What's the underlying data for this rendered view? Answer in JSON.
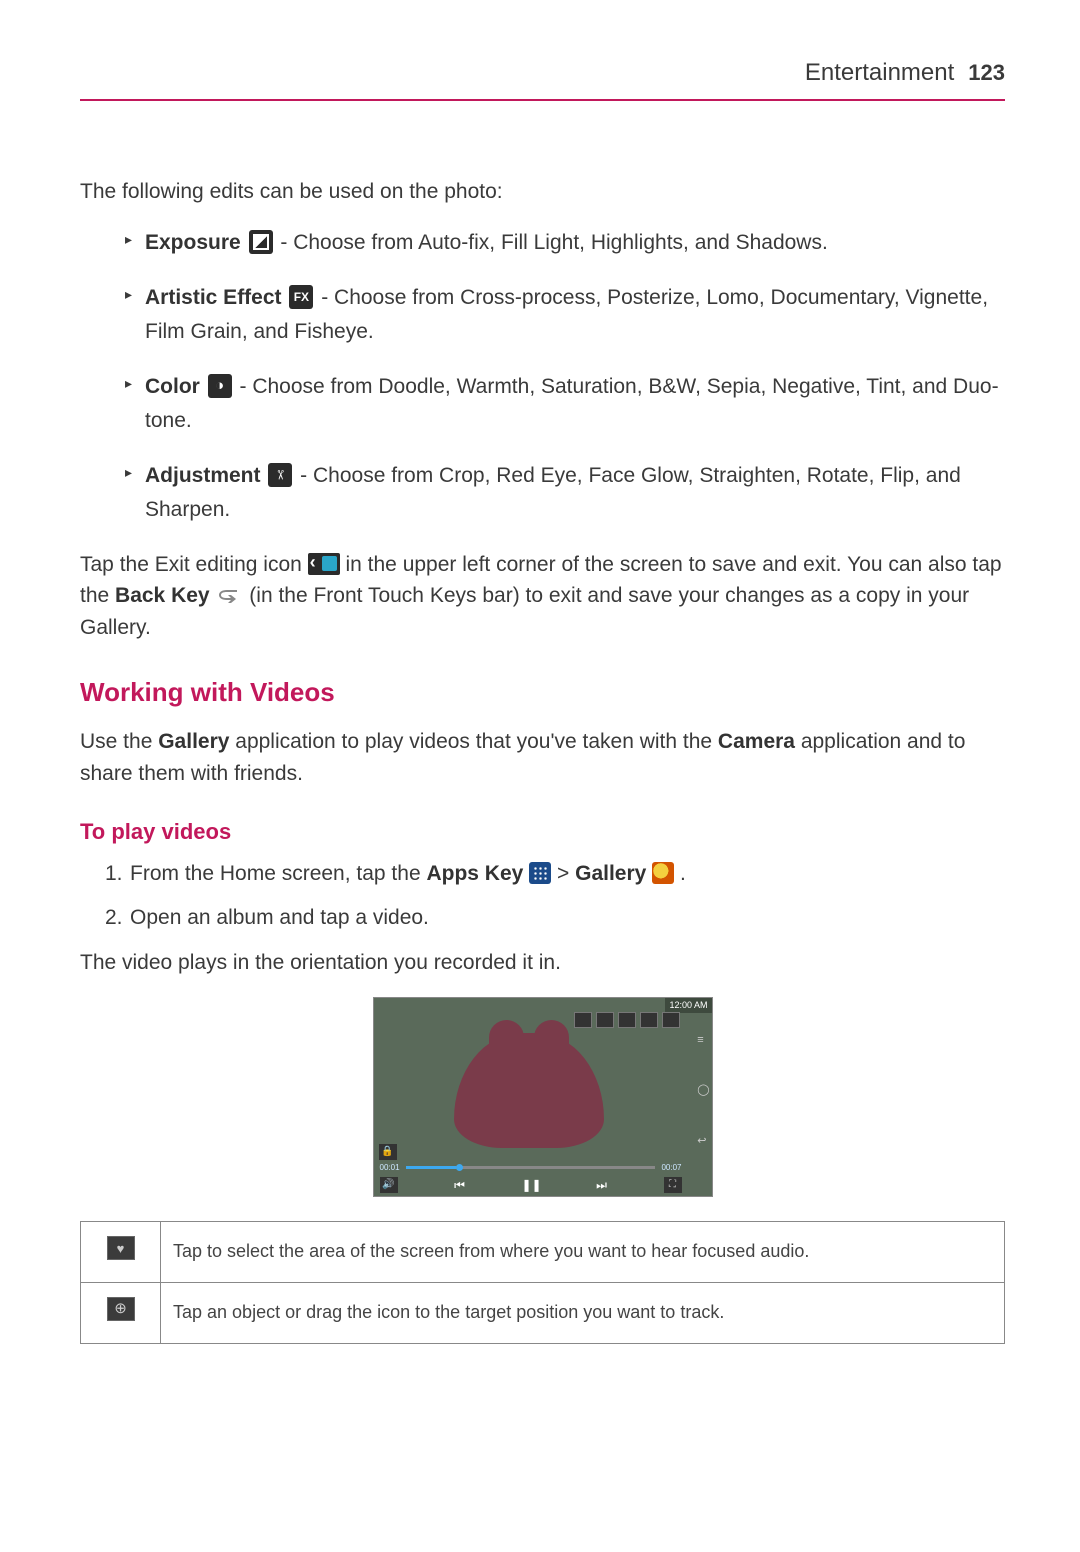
{
  "header": {
    "section": "Entertainment",
    "page": "123"
  },
  "intro": "The following edits can be used on the photo:",
  "edits": [
    {
      "label": "Exposure",
      "desc": " - Choose from Auto-fix, Fill Light, Highlights, and Shadows."
    },
    {
      "label": "Artistic Effect",
      "desc": " - Choose from Cross-process, Posterize, Lomo, Documentary, Vignette, Film Grain, and Fisheye."
    },
    {
      "label": "Color",
      "desc": " - Choose from Doodle, Warmth, Saturation, B&W, Sepia, Negative, Tint, and Duo-tone."
    },
    {
      "label": "Adjustment",
      "desc": " - Choose from Crop, Red Eye, Face Glow, Straighten, Rotate, Flip, and Sharpen."
    }
  ],
  "exit_para": {
    "p1": "Tap the Exit editing icon ",
    "p2": " in the upper left corner of the screen to save and exit.  You can also tap the ",
    "back_label": "Back Key",
    "p3": "  (in the Front Touch Keys bar) to exit and save your changes as a copy in your Gallery."
  },
  "videos": {
    "heading": "Working with Videos",
    "p_a": "Use the ",
    "gallery_b": "Gallery",
    "p_b": " application to play videos that you've taken with the ",
    "camera_b": "Camera",
    "p_c": " application and to share them with friends."
  },
  "play": {
    "heading": "To play videos",
    "steps": {
      "s1_a": "From the Home screen, tap the ",
      "s1_apps": "Apps Key",
      "s1_b": " > ",
      "s1_gallery": "Gallery",
      "s1_c": " .",
      "s2": "Open an album and tap a video."
    },
    "after": "The video plays in the orientation you recorded it in."
  },
  "shot": {
    "status": "12:00 AM",
    "t1": "00:01",
    "t2": "00:07"
  },
  "table": {
    "r1": "Tap to select the area of the screen from where you want to hear focused audio.",
    "r2": "Tap an object or drag the icon to the target position you want to track."
  }
}
